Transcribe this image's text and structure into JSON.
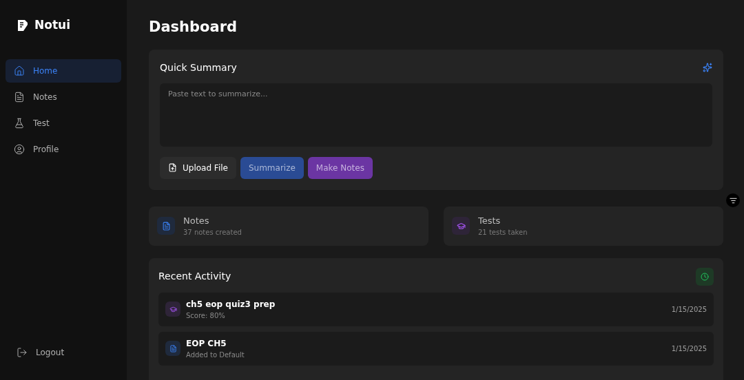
{
  "brand": {
    "name": "Notui"
  },
  "nav": [
    {
      "label": "Home",
      "kind": "home",
      "selected": true
    },
    {
      "label": "Notes",
      "kind": "notes",
      "selected": false
    },
    {
      "label": "Test",
      "kind": "test",
      "selected": false
    },
    {
      "label": "Profile",
      "kind": "profile",
      "selected": false
    }
  ],
  "logout": {
    "label": "Logout"
  },
  "page_title": "Dashboard",
  "quick_summary": {
    "title": "Quick Summary",
    "placeholder": "Paste text to summarize...",
    "buttons": [
      {
        "label": "Upload File",
        "kind": "upload"
      },
      {
        "label": "Summarize",
        "kind": "summarize"
      },
      {
        "label": "Make Notes",
        "kind": "notes"
      }
    ]
  },
  "stats": [
    {
      "kind": "notes",
      "title": "Notes",
      "subtitle": "37 notes created"
    },
    {
      "kind": "tests",
      "title": "Tests",
      "subtitle": "21 tests taken"
    }
  ],
  "recent_activity": {
    "title": "Recent Activity",
    "items": [
      {
        "kind": "test",
        "title": "ch5 eop quiz3 prep",
        "subtitle": "Score: 80%",
        "date": "1/15/2025"
      },
      {
        "kind": "note",
        "title": "EOP CH5",
        "subtitle": "Added to Default",
        "date": "1/15/2025"
      }
    ]
  }
}
